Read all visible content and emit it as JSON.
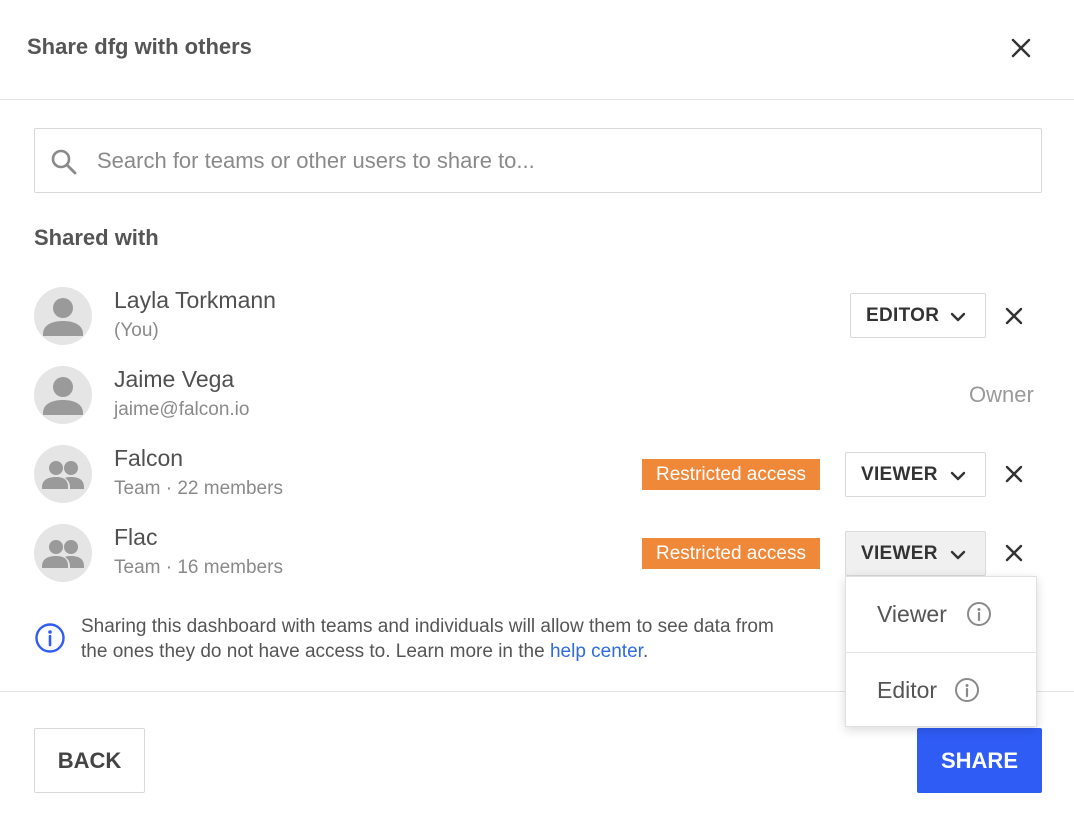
{
  "dialog": {
    "title": "Share dfg with others",
    "close_icon": "close-icon"
  },
  "search": {
    "placeholder": "Search for teams or other users to share to...",
    "value": "",
    "icon": "search-icon"
  },
  "shared_with": {
    "title": "Shared with",
    "entries": [
      {
        "name": "Layla Torkmann",
        "sub": "(You)",
        "avatar": "user-avatar-icon",
        "role": "EDITOR",
        "removable": true
      },
      {
        "name": "Jaime Vega",
        "sub": "jaime@falcon.io",
        "avatar": "user-avatar-icon",
        "owner_label": "Owner"
      },
      {
        "name": "Falcon",
        "sub": "Team · 22 members",
        "avatar": "team-avatar-icon",
        "badge": "Restricted access",
        "role": "VIEWER",
        "removable": true
      },
      {
        "name": "Flac",
        "sub": "Team · 16 members",
        "avatar": "team-avatar-icon",
        "badge": "Restricted access",
        "role": "VIEWER",
        "removable": true
      }
    ]
  },
  "info": {
    "icon": "info-icon",
    "line1": "Sharing this dashboard with teams and individuals will allow them to see data from",
    "line2_prefix": "the ones they do not have access to. Learn more in the ",
    "link_text": "help center",
    "line2_suffix": "."
  },
  "role_menu": {
    "options": [
      {
        "label": "Viewer",
        "icon": "info-circle-icon"
      },
      {
        "label": "Editor",
        "icon": "info-circle-icon"
      }
    ]
  },
  "footer": {
    "back_label": "BACK",
    "share_label": "SHARE"
  },
  "colors": {
    "accent": "#2f5cf5",
    "badge": "#f0883a",
    "link": "#2f6bdc",
    "info_icon": "#2f5cf5"
  }
}
